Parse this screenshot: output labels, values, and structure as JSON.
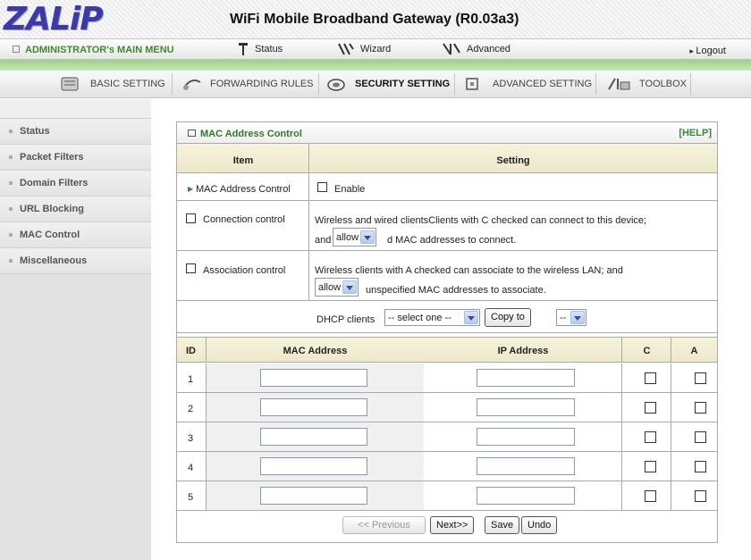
{
  "header": {
    "logo": "ZALiP",
    "title": "WiFi Mobile Broadband Gateway (R0.03a3)"
  },
  "menubar": {
    "admin": "ADMINISTRATOR's MAIN MENU",
    "status": "Status",
    "wizard": "Wizard",
    "advanced": "Advanced",
    "logout": "Logout"
  },
  "tabs": [
    "BASIC SETTING",
    "FORWARDING RULES",
    "SECURITY SETTING",
    "ADVANCED SETTING",
    "TOOLBOX"
  ],
  "sidebar": {
    "items": [
      "Status",
      "Packet Filters",
      "Domain Filters",
      "URL Blocking",
      "MAC Control",
      "Miscellaneous"
    ]
  },
  "panel": {
    "title": "MAC Address Control",
    "help": "[HELP]",
    "col_item": "Item",
    "col_setting": "Setting",
    "mac_control": {
      "label": "MAC Address Control",
      "enable": "Enable"
    },
    "connection": {
      "label": "Connection control",
      "line1": "Wireless and wired clientsClients with C checked can connect to this device;",
      "and": "and",
      "select": "allow",
      "line2": "d MAC addresses to connect."
    },
    "association": {
      "label": "Association control",
      "line1": "Wireless clients with A checked can associate to the wireless LAN; and",
      "select": "allow",
      "line2": "unspecified MAC addresses to associate."
    },
    "dhcp": {
      "label": "DHCP clients",
      "select": "-- select one --",
      "copy": "Copy to",
      "target": "--"
    },
    "table": {
      "headers": [
        "ID",
        "MAC Address",
        "IP Address",
        "C",
        "A"
      ],
      "ids": [
        "1",
        "2",
        "3",
        "4",
        "5"
      ]
    },
    "buttons": {
      "prev": "<< Previous",
      "next": "Next>>",
      "save": "Save",
      "undo": "Undo"
    }
  }
}
